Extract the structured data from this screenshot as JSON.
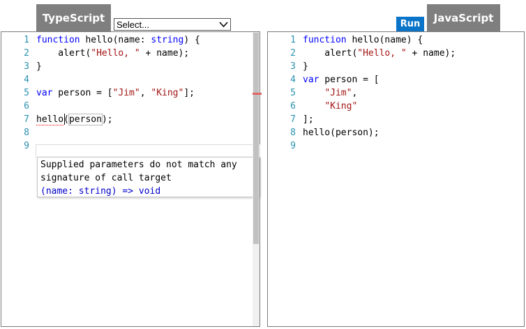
{
  "tabs": {
    "typescript_label": "TypeScript",
    "javascript_label": "JavaScript"
  },
  "examples_select": {
    "value": "Select..."
  },
  "run_button": {
    "label": "Run",
    "color": "#0a74c9"
  },
  "typescript_editor": {
    "lines": [
      {
        "num": "1",
        "tokens": [
          {
            "t": "function",
            "c": "kw"
          },
          {
            "t": " hello(name: "
          },
          {
            "t": "string",
            "c": "kw"
          },
          {
            "t": ") {"
          }
        ]
      },
      {
        "num": "2",
        "tokens": [
          {
            "t": "    alert("
          },
          {
            "t": "\"Hello, \"",
            "c": "str"
          },
          {
            "t": " + name);"
          }
        ]
      },
      {
        "num": "3",
        "tokens": [
          {
            "t": "}"
          }
        ]
      },
      {
        "num": "4",
        "tokens": []
      },
      {
        "num": "5",
        "tokens": [
          {
            "t": "var",
            "c": "kw"
          },
          {
            "t": " person = ["
          },
          {
            "t": "\"Jim\"",
            "c": "str"
          },
          {
            "t": ", "
          },
          {
            "t": "\"King\"",
            "c": "str"
          },
          {
            "t": "];"
          }
        ]
      },
      {
        "num": "6",
        "tokens": []
      },
      {
        "num": "7",
        "tokens": [
          {
            "t": "hello",
            "c": "err"
          },
          {
            "t": "("
          },
          {
            "t": "person",
            "c": "brk"
          },
          {
            "t": ");"
          }
        ]
      },
      {
        "num": "8",
        "tokens": []
      },
      {
        "num": "9",
        "tokens": []
      }
    ],
    "tooltip": {
      "message_line1": "Supplied parameters do not match any",
      "message_line2": "signature of call target",
      "signature": "(name: string) => void"
    }
  },
  "javascript_editor": {
    "lines": [
      {
        "num": "1",
        "tokens": [
          {
            "t": "function",
            "c": "kw"
          },
          {
            "t": " hello(name) {"
          }
        ]
      },
      {
        "num": "2",
        "tokens": [
          {
            "t": "    alert("
          },
          {
            "t": "\"Hello, \"",
            "c": "str"
          },
          {
            "t": " + name);"
          }
        ]
      },
      {
        "num": "3",
        "tokens": [
          {
            "t": "}"
          }
        ]
      },
      {
        "num": "4",
        "tokens": [
          {
            "t": "var",
            "c": "kw"
          },
          {
            "t": " person = ["
          }
        ]
      },
      {
        "num": "5",
        "tokens": [
          {
            "t": "    "
          },
          {
            "t": "\"Jim\"",
            "c": "str"
          },
          {
            "t": ","
          }
        ]
      },
      {
        "num": "6",
        "tokens": [
          {
            "t": "    "
          },
          {
            "t": "\"King\"",
            "c": "str"
          }
        ]
      },
      {
        "num": "7",
        "tokens": [
          {
            "t": "];"
          }
        ]
      },
      {
        "num": "8",
        "tokens": [
          {
            "t": "hello(person);"
          }
        ]
      },
      {
        "num": "9",
        "tokens": []
      }
    ]
  },
  "icons": {
    "select_arrow": "chevron-down-icon"
  },
  "colors": {
    "keyword": "#0000ff",
    "string": "#a31515",
    "line_number": "#2b91af",
    "tab_bg": "#7f7f7f",
    "error_mark": "#e06666"
  }
}
